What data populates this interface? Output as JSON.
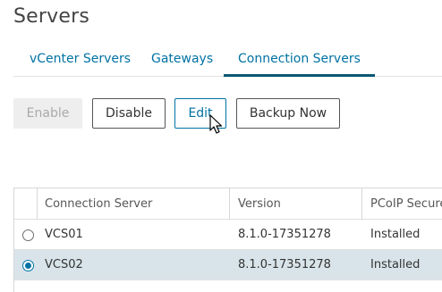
{
  "page": {
    "title": "Servers"
  },
  "tabs": [
    {
      "label": "vCenter Servers",
      "active": false
    },
    {
      "label": "Gateways",
      "active": false
    },
    {
      "label": "Connection Servers",
      "active": true
    }
  ],
  "toolbar": {
    "enable_label": "Enable",
    "disable_label": "Disable",
    "edit_label": "Edit",
    "backup_label": "Backup Now"
  },
  "table": {
    "columns": [
      "Connection Server",
      "Version",
      "PCoIP Secure"
    ],
    "rows": [
      {
        "selected": false,
        "server": "VCS01",
        "version": "8.1.0-17351278",
        "pcoip": "Installed"
      },
      {
        "selected": true,
        "server": "VCS02",
        "version": "8.1.0-17351278",
        "pcoip": "Installed"
      }
    ]
  },
  "colors": {
    "accent": "#0072a3",
    "selected_row": "#d9e4ea",
    "tab_underline": "#0b5873"
  }
}
